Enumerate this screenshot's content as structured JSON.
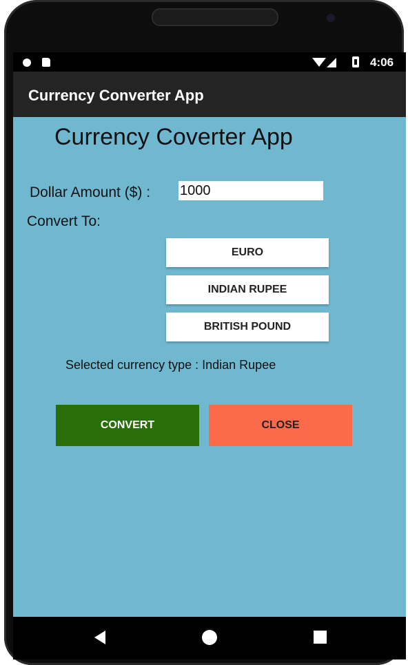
{
  "status_bar": {
    "time": "4:06",
    "icons": [
      "record-dot-icon",
      "sd-card-icon",
      "wifi-icon",
      "signal-icon",
      "battery-icon"
    ]
  },
  "app_bar": {
    "title": "Currency Converter App"
  },
  "main": {
    "heading": "Currency Coverter App",
    "dollar_label": "Dollar Amount ($) :",
    "dollar_value": "1000",
    "convert_to_label": "Convert To:",
    "options": [
      "EURO",
      "INDIAN RUPEE",
      "BRITISH POUND"
    ],
    "selected_label": "Selected currency type :",
    "selected_value": "Indian Rupee",
    "convert_button": "CONVERT",
    "close_button": "CLOSE"
  },
  "nav_bar": {
    "icons": [
      "back-icon",
      "home-icon",
      "recent-apps-icon"
    ]
  },
  "colors": {
    "background": "#6fb8d0",
    "app_bar": "#242424",
    "convert": "#2a6e0a",
    "close": "#fb6a4b"
  }
}
